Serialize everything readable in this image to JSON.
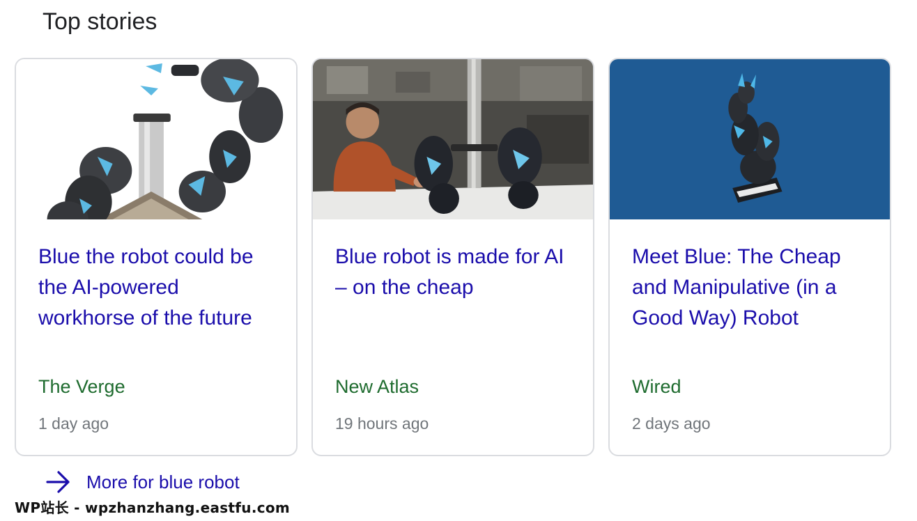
{
  "section": {
    "title": "Top stories"
  },
  "stories": [
    {
      "headline": "Blue the robot could be the AI-powered workhorse of the future",
      "source": "The Verge",
      "time": "1 day ago"
    },
    {
      "headline": "Blue robot is made for AI – on the cheap",
      "source": "New Atlas",
      "time": "19 hours ago"
    },
    {
      "headline": "Meet Blue: The Cheap and Manipulative (in a Good Way) Robot",
      "source": "Wired",
      "time": "2 days ago"
    }
  ],
  "more": {
    "label": "More for blue robot",
    "icon": "arrow-right-icon"
  },
  "watermark": "WP站长 - wpzhanzhang.eastfu.com",
  "colors": {
    "headline": "#1a0dab",
    "source": "#1e6b2e",
    "time": "#70757a",
    "card_border": "#dadce0",
    "wired_bg": "#1f5b94"
  }
}
